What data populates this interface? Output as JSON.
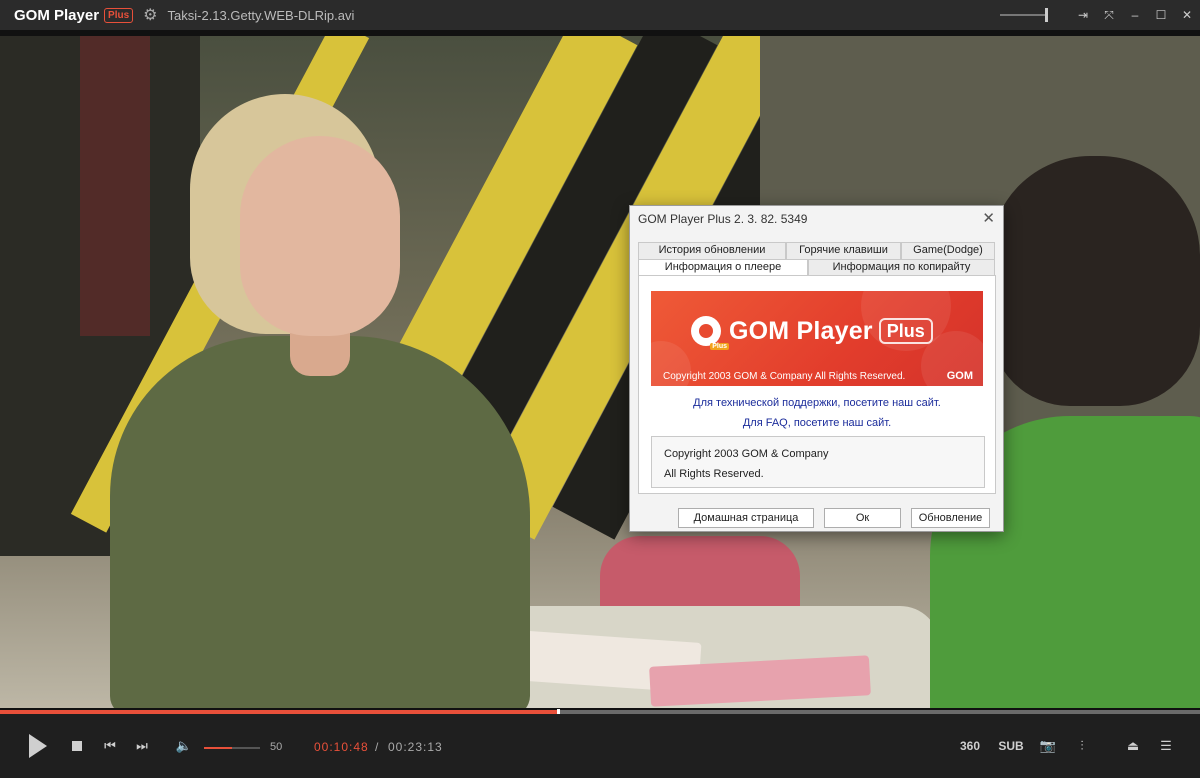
{
  "titlebar": {
    "brand": "GOM Player",
    "plus_badge": "Plus",
    "filename": "Taksi-2.13.Getty.WEB-DLRip.avi"
  },
  "dialog": {
    "title": "GOM Player Plus 2. 3. 82. 5349",
    "tabs_top": [
      "История обновлении",
      "Горячие клавиши",
      "Game(Dodge)"
    ],
    "tabs_bottom": [
      "Информация о плеере",
      "Информация по копирайту"
    ],
    "active_tab": "Информация о плеере",
    "banner": {
      "name": "GOM Player",
      "plus": "Plus",
      "icon_badge": "Plus",
      "copyright": "Copyright 2003 GOM & Company All Rights Reserved.",
      "mark": "GOM"
    },
    "support_link": "Для технической поддержки, посетите наш сайт.",
    "faq_link": "Для FAQ, посетите наш сайт.",
    "copy_line1": "Copyright 2003 GOM & Company",
    "copy_line2": "All Rights Reserved.",
    "buttons": {
      "homepage": "Домашная страница",
      "ok": "Ок",
      "update": "Обновление"
    }
  },
  "playback": {
    "progress_fraction": 0.465,
    "volume": "50",
    "volume_fraction": 0.5,
    "current_time": "00:10:48",
    "separator": "/",
    "total_time": "00:23:13"
  },
  "controls": {
    "three_sixty": "360",
    "subtitles": "SUB"
  },
  "colors": {
    "accent": "#e8503a",
    "titlebar_bg": "#2b2b2b",
    "controls_bg": "#1f1f1f"
  }
}
